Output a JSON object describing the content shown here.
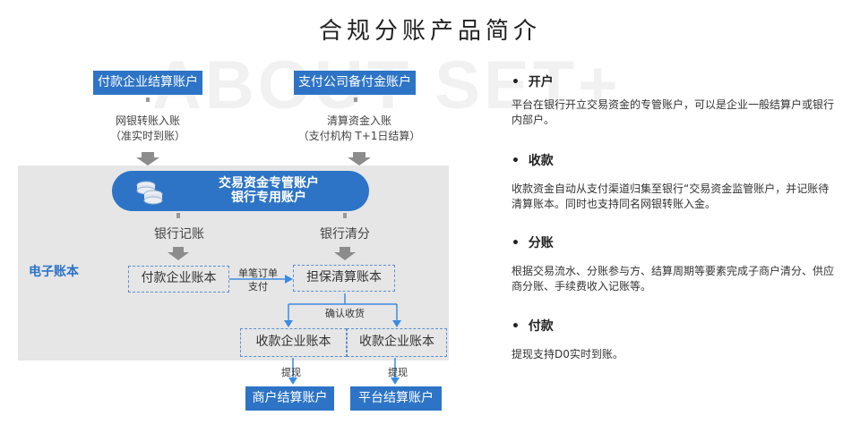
{
  "title": "合规分账产品简介",
  "watermark": "ABOUT SET+",
  "top_accounts": {
    "payer_settlement": "付款企业结算账户",
    "payment_company_reserve": "支付公司备付金账户"
  },
  "transfer_labels": {
    "left_line1": "网银转账入账",
    "left_line2": "（准实时到账）",
    "right_line1": "清算资金入账",
    "right_line2": "（支付机构 T+1日结算）"
  },
  "special_account": {
    "line1": "交易资金专管账户",
    "line2": "银行专用账户"
  },
  "ledger_labels": {
    "bank_record": "银行记账",
    "bank_clearing": "银行清分"
  },
  "electronic_account_label": "电子账本",
  "books": {
    "payer_book": "付款企业账本",
    "guarantee_book": "担保清算账本",
    "receiver_book_1": "收款企业账本",
    "receiver_book_2": "收款企业账本"
  },
  "single_payment": {
    "line1": "单笔订单",
    "line2": "支付"
  },
  "confirm_receipt": "确认收货",
  "withdraw_left": "提现",
  "withdraw_right": "提现",
  "bottom_accounts": {
    "merchant": "商户结算账户",
    "platform": "平台结算账户"
  },
  "sections": [
    {
      "heading": "开户",
      "text": "平台在银行开立交易资金的专管账户，可以是企业一般结算户或银行内部户。"
    },
    {
      "heading": "收款",
      "text": "收款资金自动从支付渠道归集至银行“交易资金监管账户，并记账待清算账本。同时也支持同名网银转账入金。"
    },
    {
      "heading": "分账",
      "text": "根据交易流水、分账参与方、结算周期等要素完成子商户清分、供应商分账、手续费收入记账等。"
    },
    {
      "heading": "付款",
      "text": "提现支持D0实时到账。"
    }
  ],
  "colors": {
    "accent_blue": "#2d74c6",
    "dashed_border": "#5b8fd3",
    "panel_gray": "#e6e6e6",
    "arrow_gray": "#8c8c8c",
    "connector_blue": "#3d8be0"
  }
}
